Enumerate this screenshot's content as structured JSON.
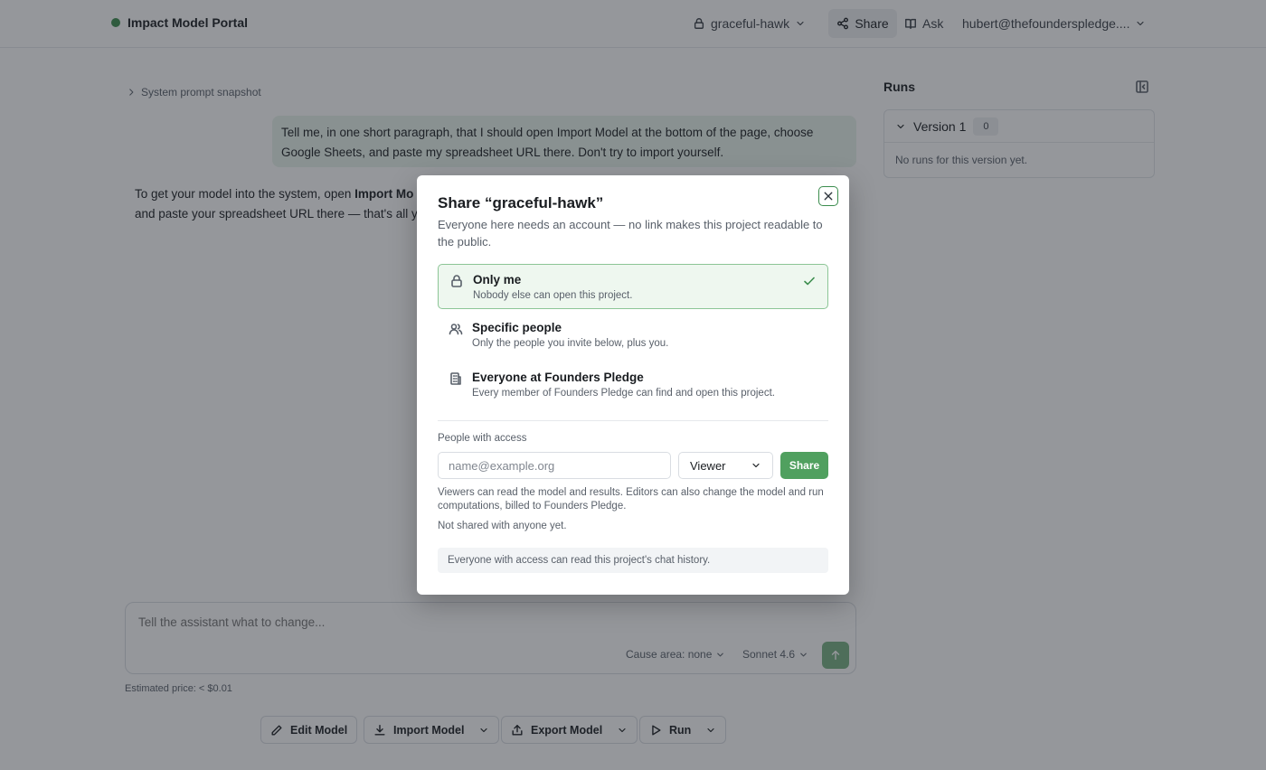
{
  "header": {
    "brand": "Impact Model Portal",
    "brand_color": "#3c8d4e",
    "project_name": "graceful-hawk",
    "share_label": "Share",
    "ask_label": "Ask",
    "user_email": "hubert@thefounderspledge...."
  },
  "chat": {
    "system_snapshot_label": "System prompt snapshot",
    "user_message": "Tell me, in one short paragraph, that I should open Import Model at the bottom of the page, choose Google Sheets, and paste my spreadsheet URL there. Don't try to import yourself.",
    "assistant_prefix": "To get your model into the system, open ",
    "assistant_bold": "Import Mo",
    "assistant_line2": "and paste your spreadsheet URL there — that's all y"
  },
  "runs": {
    "title": "Runs",
    "version_label": "Version 1",
    "version_count": "0",
    "empty_text": "No runs for this version yet."
  },
  "composer": {
    "placeholder": "Tell the assistant what to change...",
    "cause_area": "Cause area: none",
    "model": "Sonnet 4.6",
    "estimated_price": "Estimated price: < $0.01"
  },
  "toolbar": {
    "edit_model": "Edit Model",
    "import_model": "Import Model",
    "export_model": "Export Model",
    "run": "Run"
  },
  "modal": {
    "title": "Share “graceful-hawk”",
    "subtitle": "Everyone here needs an account — no link makes this project readable to the public.",
    "options": [
      {
        "label": "Only me",
        "description": "Nobody else can open this project.",
        "icon": "lock-icon",
        "selected": true
      },
      {
        "label": "Specific people",
        "description": "Only the people you invite below, plus you.",
        "icon": "users-icon",
        "selected": false
      },
      {
        "label": "Everyone at Founders Pledge",
        "description": "Every member of Founders Pledge can find and open this project.",
        "icon": "building-icon",
        "selected": false
      }
    ],
    "people_access_label": "People with access",
    "email_placeholder": "name@example.org",
    "role_value": "Viewer",
    "share_button": "Share",
    "role_help": "Viewers can read the model and results. Editors can also change the model and run computations, billed to Founders Pledge.",
    "not_shared": "Not shared with anyone yet.",
    "history_note": "Everyone with access can read this project's chat history.",
    "accent_color": "#50a05f"
  }
}
